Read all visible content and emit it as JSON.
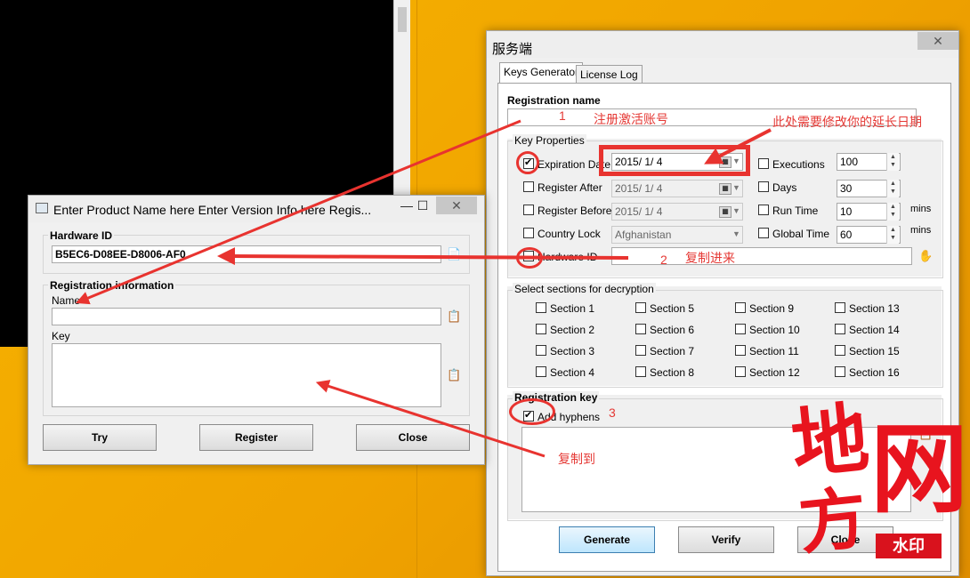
{
  "background_window": {},
  "register_dialog": {
    "title": "Enter Product Name here Enter Version Info here Regis...",
    "hardware_group_label": "Hardware ID",
    "hardware_id_value": "B5EC6-D08EE-D8006-AF0",
    "reg_group_label": "Registration information",
    "name_label": "Name",
    "name_value": "",
    "key_label": "Key",
    "key_value": "",
    "buttons": {
      "try": "Try",
      "register": "Register",
      "close": "Close"
    }
  },
  "server_dialog": {
    "title": "服务端",
    "tabs": [
      "Keys Generator",
      "License Log"
    ],
    "registration_name_label": "Registration name",
    "registration_name_value": "",
    "key_properties_label": "Key Properties",
    "expiration_date_label": "Expiration Date",
    "expiration_date_value": "2015/ 1/ 4",
    "register_after_label": "Register After",
    "register_after_value": "2015/ 1/ 4",
    "register_before_label": "Register Before",
    "register_before_value": "2015/ 1/ 4",
    "country_lock_label": "Country Lock",
    "country_value": "Afghanistan",
    "hardware_id_label": "Hardware ID",
    "hardware_id_value": "",
    "executions_label": "Executions",
    "executions_value": "100",
    "days_label": "Days",
    "days_value": "30",
    "run_time_label": "Run Time",
    "run_time_value": "10",
    "run_time_unit": "mins",
    "global_time_label": "Global Time",
    "global_time_value": "60",
    "global_time_unit": "mins",
    "sections_label": "Select sections for decryption",
    "sections": [
      "Section 1",
      "Section 5",
      "Section 9",
      "Section 13",
      "Section 2",
      "Section 6",
      "Section 10",
      "Section 14",
      "Section 3",
      "Section 7",
      "Section 11",
      "Section 15",
      "Section 4",
      "Section 8",
      "Section 12",
      "Section 16"
    ],
    "registration_key_label": "Registration key",
    "add_hyphens_label": "Add hyphens",
    "buttons": {
      "generate": "Generate",
      "verify": "Verify",
      "close": "Close"
    }
  },
  "annotations": {
    "n1": "1",
    "note1": "注册激活账号",
    "note_expiration": "此处需要修改你的延长日期",
    "n2": "2",
    "note2": "复制进来",
    "n3": "3",
    "note3": "复制到"
  },
  "watermark": {
    "char1": "地",
    "char2": "网",
    "char3": "方",
    "badge": "水印",
    "color": "#e8141e"
  },
  "colors": {
    "annotation_red": "#e8332f",
    "desktop": "#f2a900"
  }
}
